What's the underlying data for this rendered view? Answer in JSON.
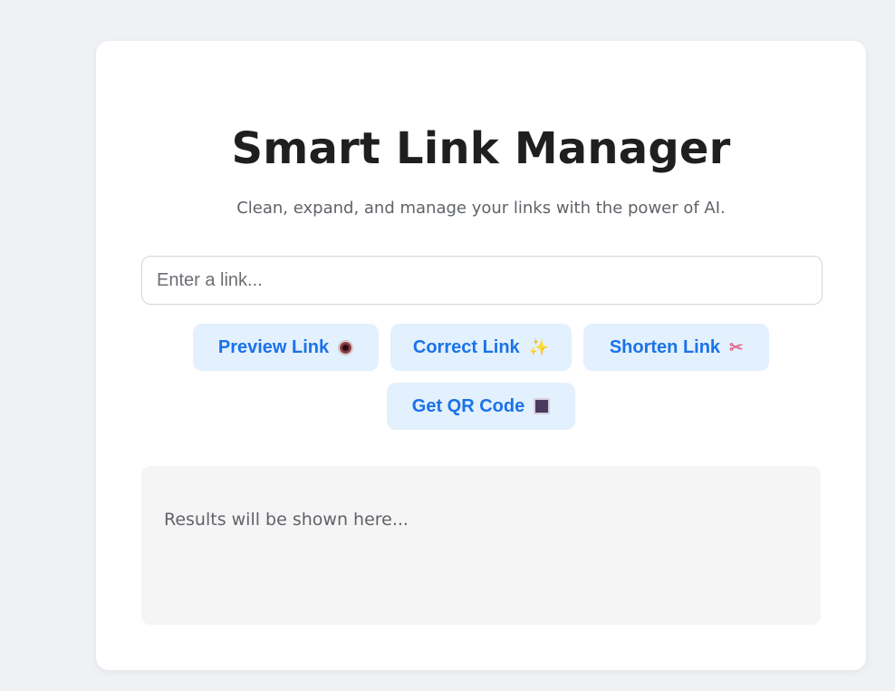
{
  "app": {
    "title": "Smart Link Manager",
    "subtitle": "Clean, expand, and manage your links with the power of AI."
  },
  "input": {
    "placeholder": "Enter a link...",
    "value": ""
  },
  "buttons": [
    {
      "label": "Preview Link",
      "icon": "eye-icon"
    },
    {
      "label": "Correct Link",
      "icon": "sparkle-icon"
    },
    {
      "label": "Shorten Link",
      "icon": "scissors-icon"
    },
    {
      "label": "Get QR Code",
      "icon": "qr-square-icon"
    }
  ],
  "results": {
    "placeholder": "Results will be shown here..."
  },
  "colors": {
    "background": "#eff1f5",
    "card": "#ffffff",
    "button_bg": "#e3f0fd",
    "button_text": "#1a73e8",
    "results_bg": "#f5f5f6"
  }
}
